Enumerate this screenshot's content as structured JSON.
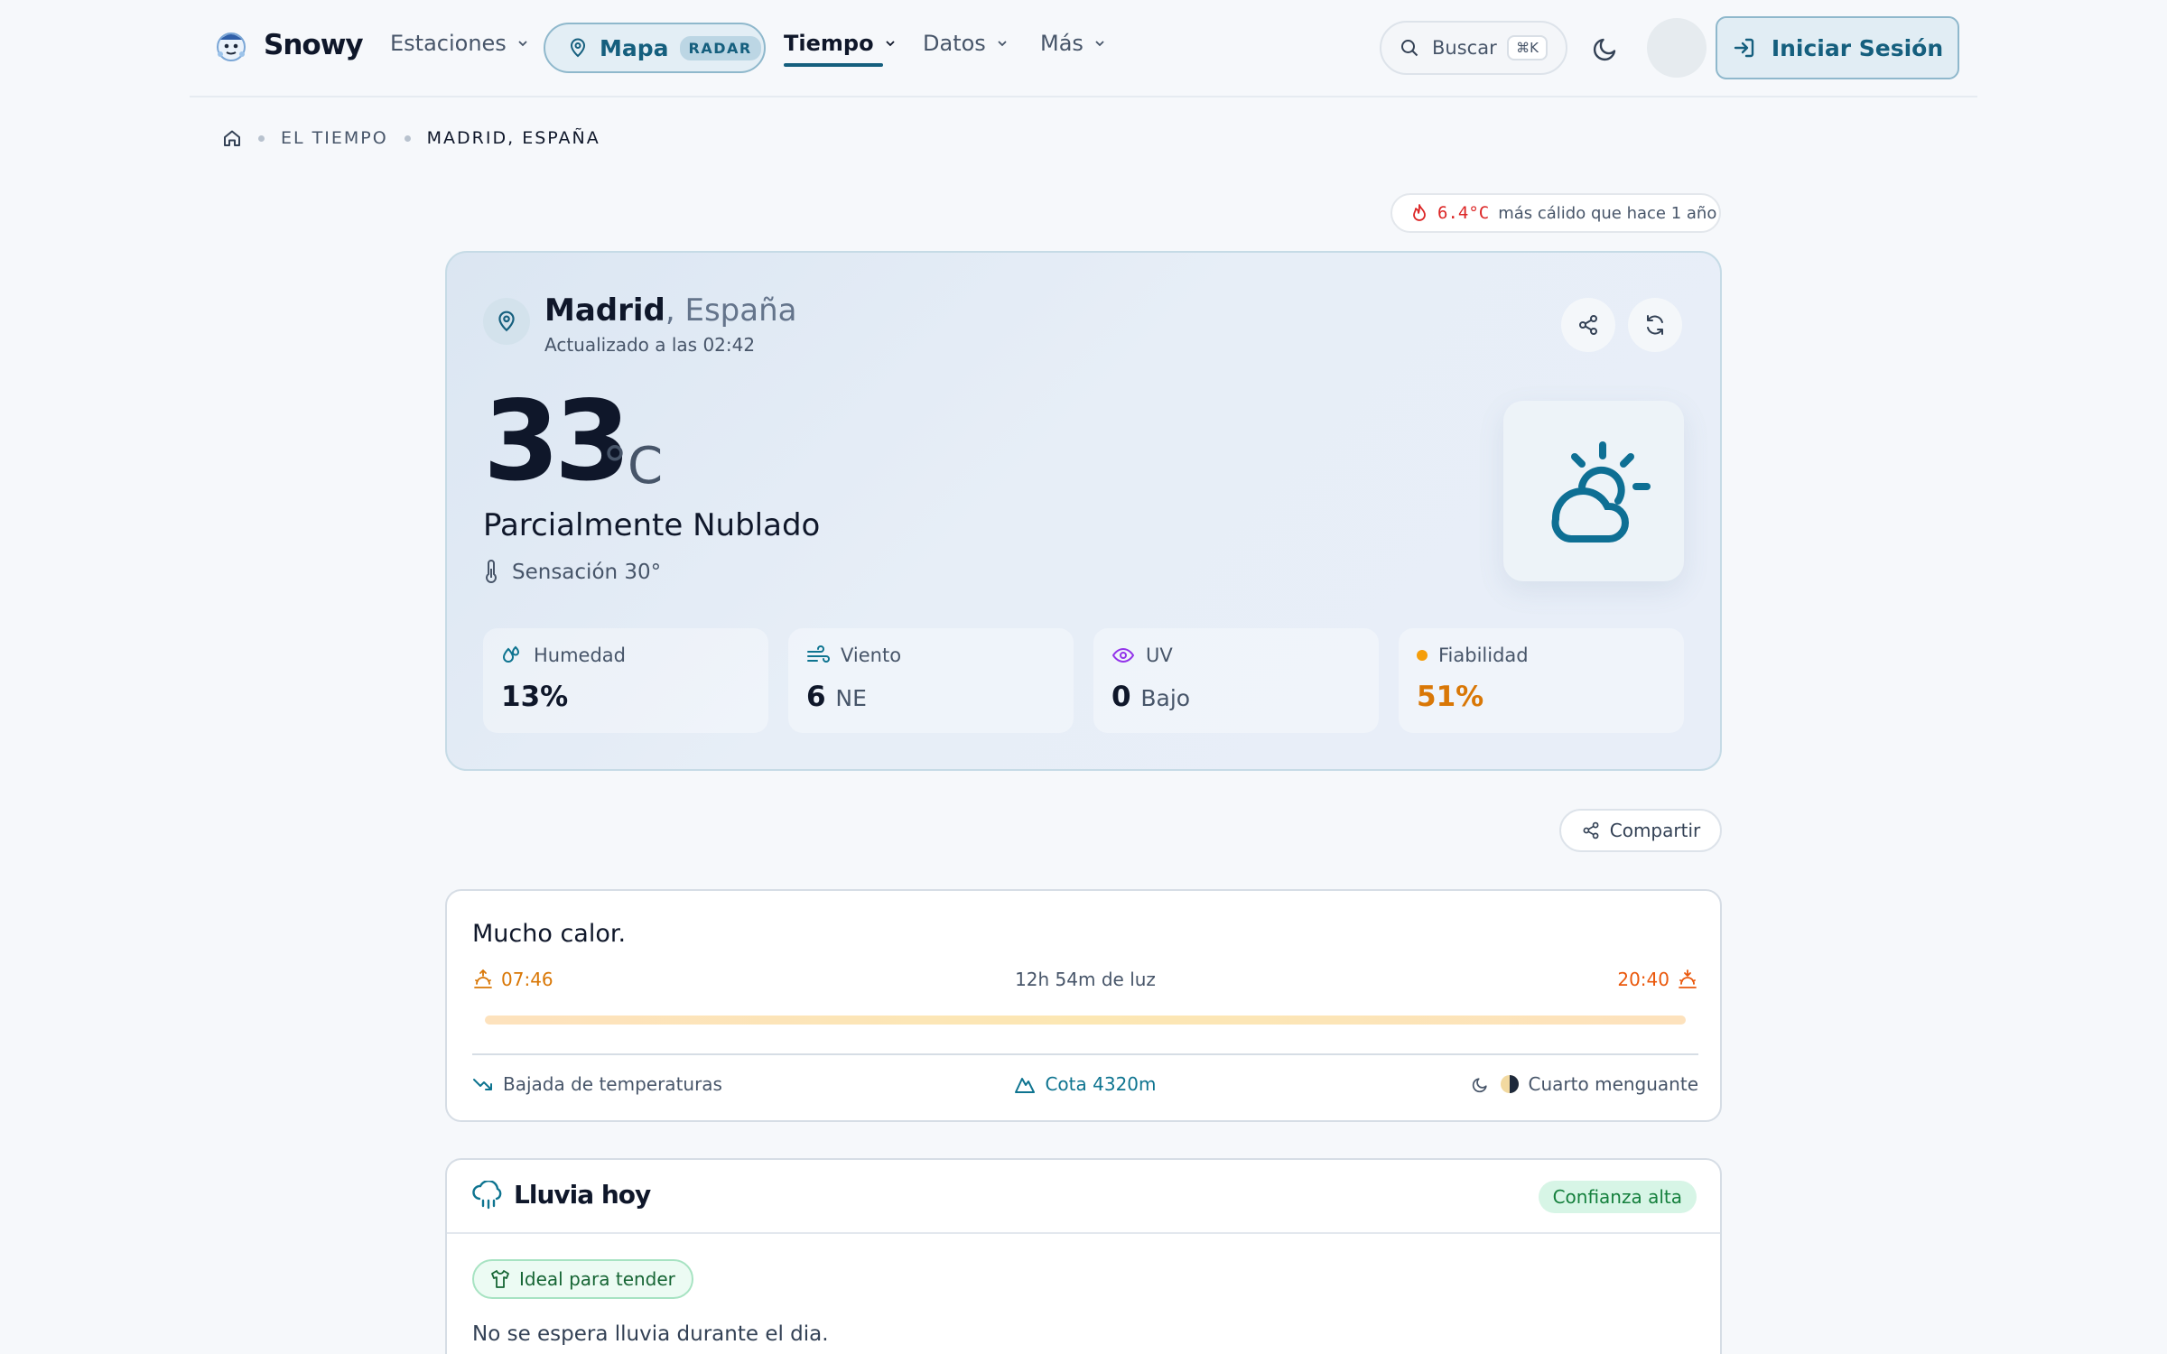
{
  "header": {
    "brand": "Snowy",
    "nav": {
      "estaciones": "Estaciones",
      "mapa": "Mapa",
      "radar_badge": "RADAR",
      "tiempo": "Tiempo",
      "datos": "Datos",
      "mas": "Más"
    },
    "search": {
      "placeholder": "Buscar",
      "shortcut": "⌘K"
    },
    "login_label": "Iniciar Sesión"
  },
  "breadcrumb": {
    "section": "EL TIEMPO",
    "current": "MADRID, ESPAÑA"
  },
  "comparison": {
    "value": "6.4°C",
    "text": "más cálido que hace 1 año"
  },
  "current": {
    "city": "Madrid",
    "country": ", España",
    "updated": "Actualizado a las 02:42",
    "temperature": "33",
    "unit": "°C",
    "condition": "Parcialmente Nublado",
    "feels_like": "Sensación 30°",
    "icon": "partly-cloudy-icon",
    "stats": {
      "humidity": {
        "label": "Humedad",
        "value": "13%"
      },
      "wind": {
        "label": "Viento",
        "value": "6",
        "dir": "NE"
      },
      "uv": {
        "label": "UV",
        "value": "0",
        "level": "Bajo"
      },
      "reliability": {
        "label": "Fiabilidad",
        "value": "51%"
      }
    }
  },
  "share_label": "Compartir",
  "summary": {
    "title": "Mucho calor.",
    "sunrise": "07:46",
    "daylight": "12h 54m de luz",
    "sunset": "20:40",
    "trend": "Bajada de temperaturas",
    "snow_level": "Cota 4320m",
    "moon_phase": "Cuarto menguante"
  },
  "rain": {
    "title": "Lluvia hoy",
    "confidence": "Confianza alta",
    "tag": "Ideal para tender",
    "description": "No se espera lluvia durante el dia."
  },
  "colors": {
    "brand": "#155f7e",
    "warm": "#dc2626",
    "reliability": "#d97706",
    "success": "#15803d"
  }
}
